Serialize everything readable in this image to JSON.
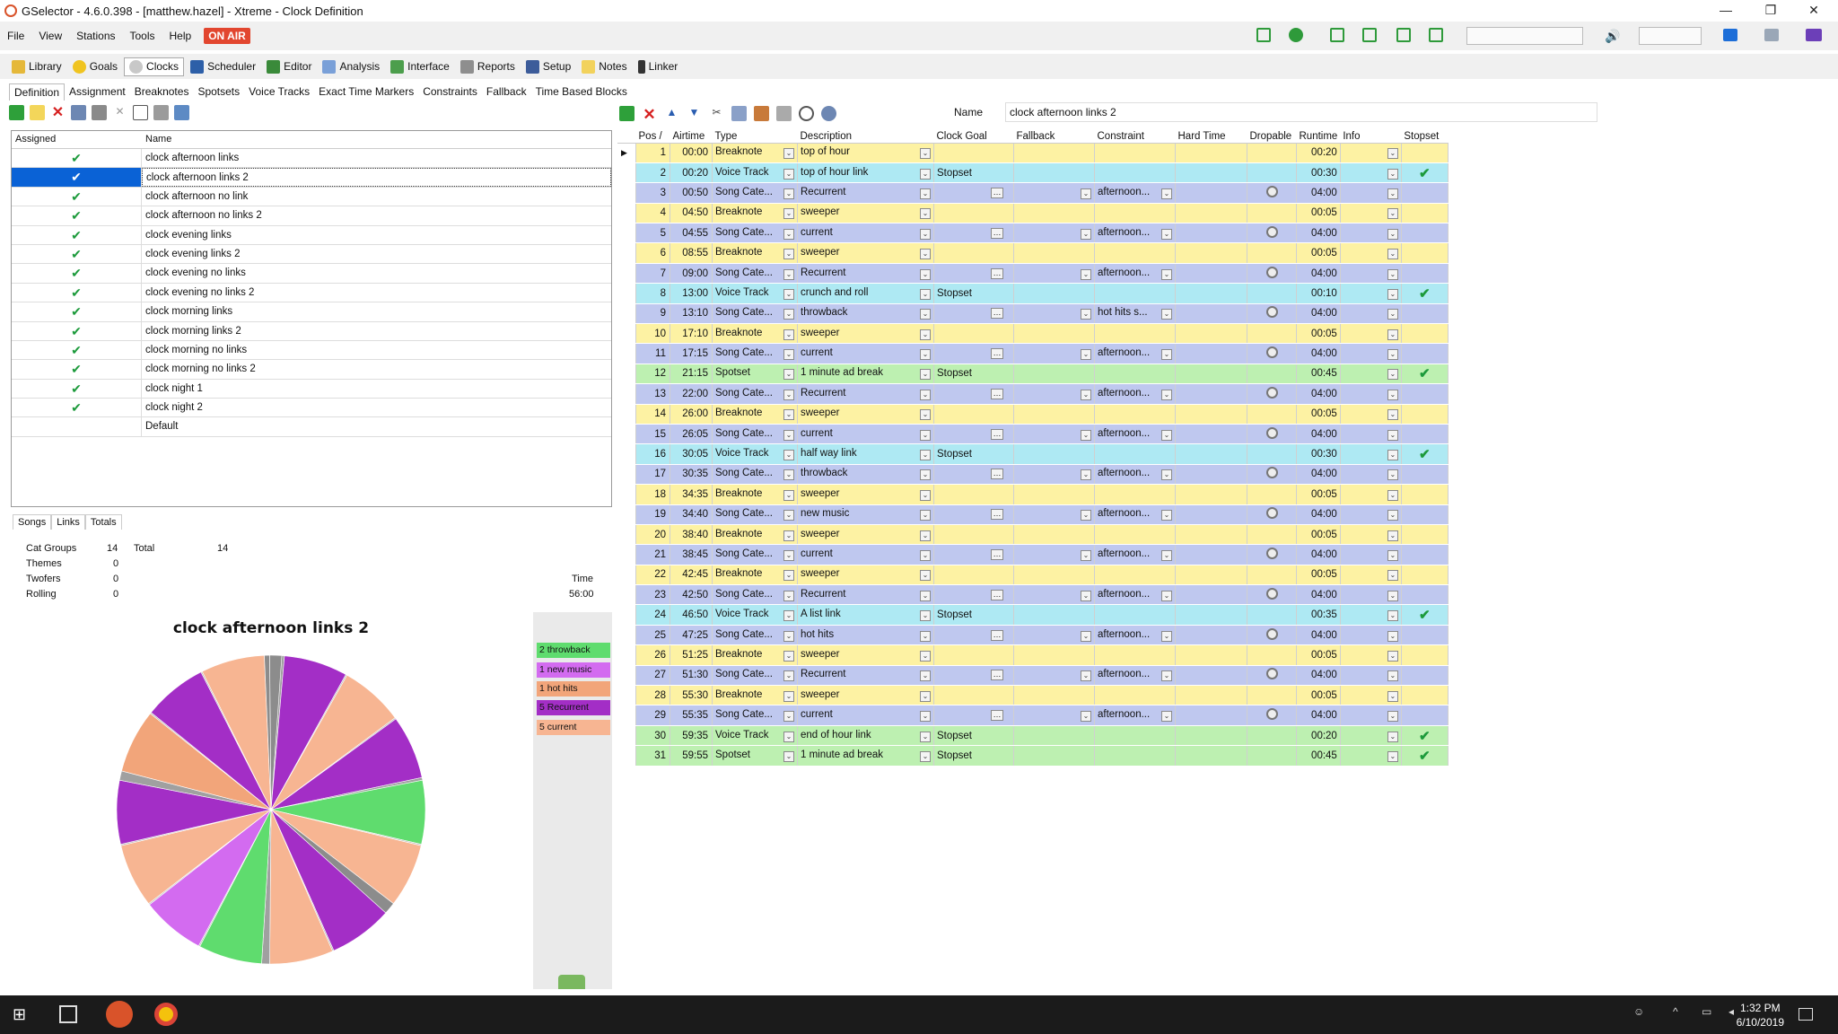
{
  "window": {
    "title": "GSelector - 4.6.0.398 - [matthew.hazel] - Xtreme - Clock Definition"
  },
  "menu": {
    "items": [
      "File",
      "View",
      "Stations",
      "Tools",
      "Help"
    ],
    "on_air": "ON AIR"
  },
  "modules": [
    "Library",
    "Goals",
    "Clocks",
    "Scheduler",
    "Editor",
    "Analysis",
    "Interface",
    "Reports",
    "Setup",
    "Notes",
    "Linker"
  ],
  "subtabs": [
    "Definition",
    "Assignment",
    "Breaknotes",
    "Spotsets",
    "Voice Tracks",
    "Exact Time Markers",
    "Constraints",
    "Fallback",
    "Time Based Blocks"
  ],
  "left_grid": {
    "headers": {
      "assigned": "Assigned",
      "name": "Name"
    },
    "rows": [
      {
        "assigned": "✔",
        "name": "clock afternoon links"
      },
      {
        "assigned": "✔",
        "name": "clock afternoon links 2"
      },
      {
        "assigned": "✔",
        "name": "clock afternoon no link"
      },
      {
        "assigned": "✔",
        "name": "clock afternoon no links 2"
      },
      {
        "assigned": "✔",
        "name": "clock evening links"
      },
      {
        "assigned": "✔",
        "name": "clock evening links 2"
      },
      {
        "assigned": "✔",
        "name": "clock evening no links"
      },
      {
        "assigned": "✔",
        "name": "clock evening no links 2"
      },
      {
        "assigned": "✔",
        "name": "clock morning links"
      },
      {
        "assigned": "✔",
        "name": "clock morning links 2"
      },
      {
        "assigned": "✔",
        "name": "clock morning no links"
      },
      {
        "assigned": "✔",
        "name": "clock morning no links 2"
      },
      {
        "assigned": "✔",
        "name": "clock night 1"
      },
      {
        "assigned": "✔",
        "name": "clock night 2"
      },
      {
        "assigned": "",
        "name": "Default"
      }
    ]
  },
  "summary_tabs": [
    "Songs",
    "Links",
    "Totals"
  ],
  "stats": {
    "cat_groups_label": "Cat Groups",
    "cat_groups": "14",
    "total_label": "Total",
    "total": "14",
    "themes_label": "Themes",
    "themes": "0",
    "twofers_label": "Twofers",
    "twofers": "0",
    "rolling_label": "Rolling",
    "rolling": "0",
    "time_label": "Time",
    "time": "56:00"
  },
  "pie": {
    "title": "clock afternoon links 2",
    "legend": [
      {
        "label": "2 throwback",
        "color": "#5fdc6e"
      },
      {
        "label": "1 new music",
        "color": "#d36bf0"
      },
      {
        "label": "1 hot hits",
        "color": "#f2a57a"
      },
      {
        "label": "5 Recurrent",
        "color": "#a32ec6"
      },
      {
        "label": "5 current",
        "color": "#f7b592"
      }
    ]
  },
  "name_field": {
    "label": "Name",
    "value": "clock afternoon links 2"
  },
  "clock_grid": {
    "headers": [
      "Pos /",
      "Airtime",
      "Type",
      "Description",
      "Clock Goal",
      "Fallback",
      "Constraint",
      "Hard Time",
      "Dropable",
      "Runtime",
      "Info",
      "Stopset"
    ],
    "rows": [
      {
        "pos": "1",
        "air": "00:00",
        "type": "Breaknote",
        "desc": "top of hour",
        "goal": "",
        "constraint": "",
        "drop": false,
        "run": "00:20",
        "stop": false,
        "kind": "bk"
      },
      {
        "pos": "2",
        "air": "00:20",
        "type": "Voice Track",
        "desc": "top of hour link",
        "goal": "Stopset",
        "constraint": "",
        "drop": false,
        "run": "00:30",
        "stop": true,
        "kind": "vt"
      },
      {
        "pos": "3",
        "air": "00:50",
        "type": "Song Cate...",
        "desc": "Recurrent",
        "goal": "",
        "constraint": "afternoon...",
        "drop": true,
        "run": "04:00",
        "stop": false,
        "kind": "sc"
      },
      {
        "pos": "4",
        "air": "04:50",
        "type": "Breaknote",
        "desc": "sweeper",
        "goal": "",
        "constraint": "",
        "drop": false,
        "run": "00:05",
        "stop": false,
        "kind": "bk"
      },
      {
        "pos": "5",
        "air": "04:55",
        "type": "Song Cate...",
        "desc": "current",
        "goal": "",
        "constraint": "afternoon...",
        "drop": true,
        "run": "04:00",
        "stop": false,
        "kind": "sc"
      },
      {
        "pos": "6",
        "air": "08:55",
        "type": "Breaknote",
        "desc": "sweeper",
        "goal": "",
        "constraint": "",
        "drop": false,
        "run": "00:05",
        "stop": false,
        "kind": "bk"
      },
      {
        "pos": "7",
        "air": "09:00",
        "type": "Song Cate...",
        "desc": "Recurrent",
        "goal": "",
        "constraint": "afternoon...",
        "drop": true,
        "run": "04:00",
        "stop": false,
        "kind": "sc"
      },
      {
        "pos": "8",
        "air": "13:00",
        "type": "Voice Track",
        "desc": "crunch and roll",
        "goal": "Stopset",
        "constraint": "",
        "drop": false,
        "run": "00:10",
        "stop": true,
        "kind": "vt"
      },
      {
        "pos": "9",
        "air": "13:10",
        "type": "Song Cate...",
        "desc": "throwback",
        "goal": "",
        "constraint": "hot hits s...",
        "drop": true,
        "run": "04:00",
        "stop": false,
        "kind": "sc"
      },
      {
        "pos": "10",
        "air": "17:10",
        "type": "Breaknote",
        "desc": "sweeper",
        "goal": "",
        "constraint": "",
        "drop": false,
        "run": "00:05",
        "stop": false,
        "kind": "bk"
      },
      {
        "pos": "11",
        "air": "17:15",
        "type": "Song Cate...",
        "desc": "current",
        "goal": "",
        "constraint": "afternoon...",
        "drop": true,
        "run": "04:00",
        "stop": false,
        "kind": "sc"
      },
      {
        "pos": "12",
        "air": "21:15",
        "type": "Spotset",
        "desc": "1 minute ad break",
        "goal": "Stopset",
        "constraint": "",
        "drop": false,
        "run": "00:45",
        "stop": true,
        "kind": "sp"
      },
      {
        "pos": "13",
        "air": "22:00",
        "type": "Song Cate...",
        "desc": "Recurrent",
        "goal": "",
        "constraint": "afternoon...",
        "drop": true,
        "run": "04:00",
        "stop": false,
        "kind": "sc"
      },
      {
        "pos": "14",
        "air": "26:00",
        "type": "Breaknote",
        "desc": "sweeper",
        "goal": "",
        "constraint": "",
        "drop": false,
        "run": "00:05",
        "stop": false,
        "kind": "bk"
      },
      {
        "pos": "15",
        "air": "26:05",
        "type": "Song Cate...",
        "desc": "current",
        "goal": "",
        "constraint": "afternoon...",
        "drop": true,
        "run": "04:00",
        "stop": false,
        "kind": "sc"
      },
      {
        "pos": "16",
        "air": "30:05",
        "type": "Voice Track",
        "desc": "half way link",
        "goal": "Stopset",
        "constraint": "",
        "drop": false,
        "run": "00:30",
        "stop": true,
        "kind": "vt"
      },
      {
        "pos": "17",
        "air": "30:35",
        "type": "Song Cate...",
        "desc": "throwback",
        "goal": "",
        "constraint": "afternoon...",
        "drop": true,
        "run": "04:00",
        "stop": false,
        "kind": "sc"
      },
      {
        "pos": "18",
        "air": "34:35",
        "type": "Breaknote",
        "desc": "sweeper",
        "goal": "",
        "constraint": "",
        "drop": false,
        "run": "00:05",
        "stop": false,
        "kind": "bk"
      },
      {
        "pos": "19",
        "air": "34:40",
        "type": "Song Cate...",
        "desc": "new music",
        "goal": "",
        "constraint": "afternoon...",
        "drop": true,
        "run": "04:00",
        "stop": false,
        "kind": "sc"
      },
      {
        "pos": "20",
        "air": "38:40",
        "type": "Breaknote",
        "desc": "sweeper",
        "goal": "",
        "constraint": "",
        "drop": false,
        "run": "00:05",
        "stop": false,
        "kind": "bk"
      },
      {
        "pos": "21",
        "air": "38:45",
        "type": "Song Cate...",
        "desc": "current",
        "goal": "",
        "constraint": "afternoon...",
        "drop": true,
        "run": "04:00",
        "stop": false,
        "kind": "sc"
      },
      {
        "pos": "22",
        "air": "42:45",
        "type": "Breaknote",
        "desc": "sweeper",
        "goal": "",
        "constraint": "",
        "drop": false,
        "run": "00:05",
        "stop": false,
        "kind": "bk"
      },
      {
        "pos": "23",
        "air": "42:50",
        "type": "Song Cate...",
        "desc": "Recurrent",
        "goal": "",
        "constraint": "afternoon...",
        "drop": true,
        "run": "04:00",
        "stop": false,
        "kind": "sc"
      },
      {
        "pos": "24",
        "air": "46:50",
        "type": "Voice Track",
        "desc": "A list link",
        "goal": "Stopset",
        "constraint": "",
        "drop": false,
        "run": "00:35",
        "stop": true,
        "kind": "vt"
      },
      {
        "pos": "25",
        "air": "47:25",
        "type": "Song Cate...",
        "desc": "hot hits",
        "goal": "",
        "constraint": "afternoon...",
        "drop": true,
        "run": "04:00",
        "stop": false,
        "kind": "sc"
      },
      {
        "pos": "26",
        "air": "51:25",
        "type": "Breaknote",
        "desc": "sweeper",
        "goal": "",
        "constraint": "",
        "drop": false,
        "run": "00:05",
        "stop": false,
        "kind": "bk"
      },
      {
        "pos": "27",
        "air": "51:30",
        "type": "Song Cate...",
        "desc": "Recurrent",
        "goal": "",
        "constraint": "afternoon...",
        "drop": true,
        "run": "04:00",
        "stop": false,
        "kind": "sc"
      },
      {
        "pos": "28",
        "air": "55:30",
        "type": "Breaknote",
        "desc": "sweeper",
        "goal": "",
        "constraint": "",
        "drop": false,
        "run": "00:05",
        "stop": false,
        "kind": "bk"
      },
      {
        "pos": "29",
        "air": "55:35",
        "type": "Song Cate...",
        "desc": "current",
        "goal": "",
        "constraint": "afternoon...",
        "drop": true,
        "run": "04:00",
        "stop": false,
        "kind": "sc"
      },
      {
        "pos": "30",
        "air": "59:35",
        "type": "Voice Track",
        "desc": "end of hour link",
        "goal": "Stopset",
        "constraint": "",
        "drop": false,
        "run": "00:20",
        "stop": true,
        "kind": "sp"
      },
      {
        "pos": "31",
        "air": "59:55",
        "type": "Spotset",
        "desc": "1 minute ad break",
        "goal": "Stopset",
        "constraint": "",
        "drop": false,
        "run": "00:45",
        "stop": true,
        "kind": "sp"
      }
    ]
  },
  "taskbar": {
    "time": "1:32 PM",
    "date": "6/10/2019"
  }
}
